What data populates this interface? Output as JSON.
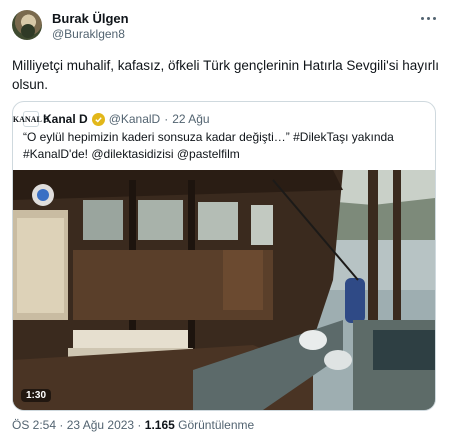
{
  "author": {
    "name": "Burak Ülgen",
    "handle": "@Buraklgen8"
  },
  "tweet": {
    "text": "Milliyetçi muhalif, kafasız, öfkeli Türk gençlerinin Hatırla Sevgili'si hayırlı olsun."
  },
  "quoted": {
    "avatar_text": "KANAL D",
    "name": "Kanal D",
    "handle": "@KanalD",
    "separator": "·",
    "date": "22 Ağu",
    "text": "“O eylül hepimizin kaderi sonsuza kadar değişti…” #DilekTaşı yakında #KanalD'de! @dilektasidizisi @pastelfilm",
    "video_time": "1:30"
  },
  "meta": {
    "time_date": "ÖS 2:54 · 23 Ağu 2023 · ",
    "views_count": "1.165",
    "views_label": " Görüntülenme"
  },
  "colors": {
    "text_primary": "#0f1419",
    "text_secondary": "#536471",
    "border": "#cfd9de",
    "verified_gold": "#e2b719"
  }
}
